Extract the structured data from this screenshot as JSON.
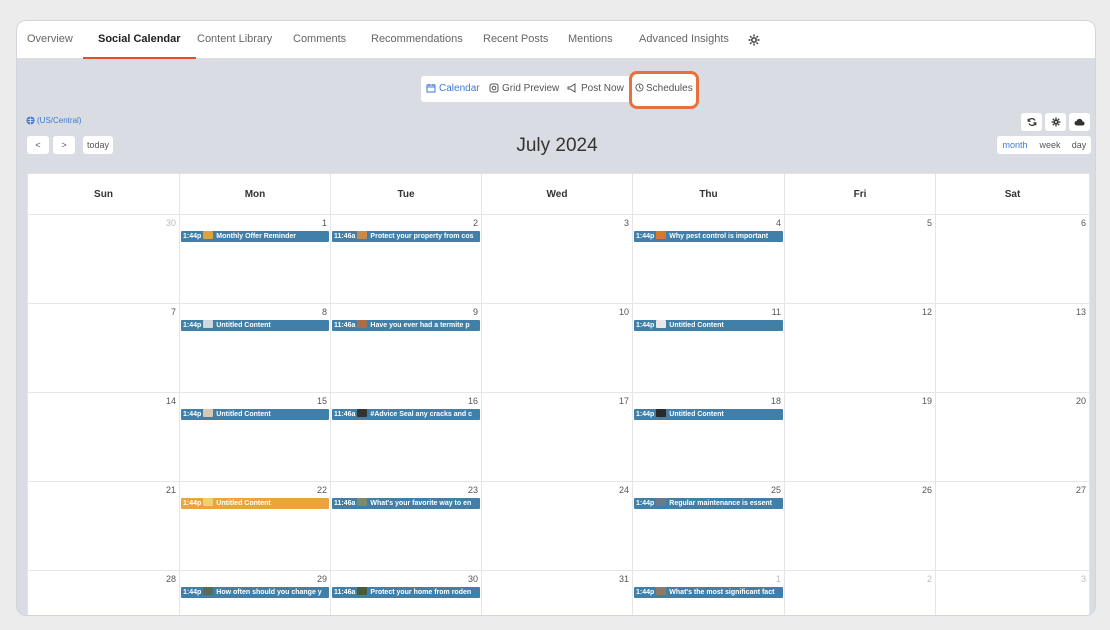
{
  "tabs": [
    {
      "label": "Overview",
      "active": false
    },
    {
      "label": "Social Calendar",
      "active": true
    },
    {
      "label": "Content Library",
      "active": false
    },
    {
      "label": "Comments",
      "active": false
    },
    {
      "label": "Recommendations",
      "active": false
    },
    {
      "label": "Recent Posts",
      "active": false
    },
    {
      "label": "Mentions",
      "active": false
    },
    {
      "label": "Advanced Insights",
      "active": false
    }
  ],
  "views": {
    "calendar": "Calendar",
    "grid_preview": "Grid Preview",
    "post_now": "Post Now",
    "schedules": "Schedules"
  },
  "timezone": "(US/Central)",
  "nav": {
    "prev": "<",
    "next": ">",
    "today": "today"
  },
  "title": "July 2024",
  "range_buttons": {
    "month": "month",
    "week": "week",
    "day": "day",
    "active": "month"
  },
  "toolbar_icons": [
    "refresh-icon",
    "settings-icon",
    "cloud-icon"
  ],
  "weekdays": [
    "Sun",
    "Mon",
    "Tue",
    "Wed",
    "Thu",
    "Fri",
    "Sat"
  ],
  "colors": {
    "accent": "#3a7bd5",
    "event": "#3f7fa8",
    "event_alt": "#eba43c",
    "highlight": "#e8703a",
    "tab_underline": "#e0502a"
  },
  "weeks": [
    [
      {
        "day": "30",
        "muted": true
      },
      {
        "day": "1",
        "event": {
          "time": "1:44p",
          "text": "Monthly Offer Reminder",
          "thumb": "#e0a33a"
        }
      },
      {
        "day": "2",
        "event": {
          "time": "11:46a",
          "text": "Protect your property from cos",
          "thumb": "#c98a4a"
        }
      },
      {
        "day": "3"
      },
      {
        "day": "4",
        "event": {
          "time": "1:44p",
          "text": "Why pest control is important",
          "thumb": "#d9772e"
        }
      },
      {
        "day": "5"
      },
      {
        "day": "6"
      }
    ],
    [
      {
        "day": "7"
      },
      {
        "day": "8",
        "event": {
          "time": "1:44p",
          "text": "Untitled Content",
          "thumb": "#cfd8e0"
        }
      },
      {
        "day": "9",
        "event": {
          "time": "11:46a",
          "text": "Have you ever had a termite p",
          "thumb": "#a86d4a"
        }
      },
      {
        "day": "10"
      },
      {
        "day": "11",
        "event": {
          "time": "1:44p",
          "text": "Untitled Content",
          "thumb": "#e8e8e8"
        }
      },
      {
        "day": "12"
      },
      {
        "day": "13"
      }
    ],
    [
      {
        "day": "14"
      },
      {
        "day": "15",
        "event": {
          "time": "1:44p",
          "text": "Untitled Content",
          "thumb": "#d8c8b0"
        }
      },
      {
        "day": "16",
        "event": {
          "time": "11:46a",
          "text": "#Advice Seal any cracks and c",
          "thumb": "#333333"
        }
      },
      {
        "day": "17"
      },
      {
        "day": "18",
        "event": {
          "time": "1:44p",
          "text": "Untitled Content",
          "thumb": "#2a2a2a"
        }
      },
      {
        "day": "19"
      },
      {
        "day": "20"
      }
    ],
    [
      {
        "day": "21"
      },
      {
        "day": "22",
        "event": {
          "time": "1:44p",
          "text": "Untitled Content",
          "thumb": "#f0d070",
          "orange": true
        }
      },
      {
        "day": "23",
        "event": {
          "time": "11:46a",
          "text": "What's your favorite way to en",
          "thumb": "#7a8a6a"
        }
      },
      {
        "day": "24"
      },
      {
        "day": "25",
        "event": {
          "time": "1:44p",
          "text": "Regular maintenance is essent",
          "thumb": "#6a7a8a"
        }
      },
      {
        "day": "26"
      },
      {
        "day": "27"
      }
    ],
    [
      {
        "day": "28"
      },
      {
        "day": "29",
        "event": {
          "time": "1:44p",
          "text": "How often should you change y",
          "thumb": "#5a6a5a"
        }
      },
      {
        "day": "30",
        "event": {
          "time": "11:46a",
          "text": "Protect your home from roden",
          "thumb": "#4a5a3a"
        }
      },
      {
        "day": "31"
      },
      {
        "day": "1",
        "muted": true,
        "event": {
          "time": "1:44p",
          "text": "What's the most significant fact",
          "thumb": "#8a7a6a"
        }
      },
      {
        "day": "2",
        "muted": true
      },
      {
        "day": "3",
        "muted": true
      }
    ]
  ]
}
